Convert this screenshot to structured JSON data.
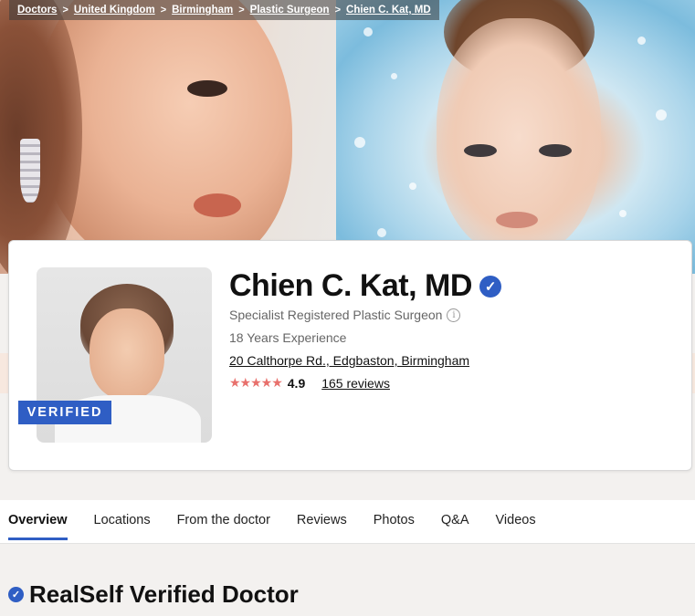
{
  "breadcrumb": {
    "items": [
      "Doctors",
      "United Kingdom",
      "Birmingham",
      "Plastic Surgeon",
      "Chien C. Kat, MD"
    ],
    "separator": ">"
  },
  "profile": {
    "name": "Chien C. Kat, MD",
    "verified_badge": "VERIFIED",
    "specialty": "Specialist Registered Plastic Surgeon",
    "experience": "18 Years Experience",
    "address": "20 Calthorpe Rd., Edgbaston, Birmingham",
    "stars": "★★★★★",
    "rating": "4.9",
    "reviews_link": "165 reviews"
  },
  "tabs": [
    {
      "label": "Overview",
      "active": true
    },
    {
      "label": "Locations",
      "active": false
    },
    {
      "label": "From the doctor",
      "active": false
    },
    {
      "label": "Reviews",
      "active": false
    },
    {
      "label": "Photos",
      "active": false
    },
    {
      "label": "Q&A",
      "active": false
    },
    {
      "label": "Videos",
      "active": false
    }
  ],
  "section": {
    "title": "RealSelf Verified Doctor"
  },
  "icons": {
    "verified": "verified-check-icon",
    "info": "info-icon",
    "star": "star-icon"
  },
  "colors": {
    "accent": "#2f5ec4",
    "stars": "#e8706c"
  }
}
